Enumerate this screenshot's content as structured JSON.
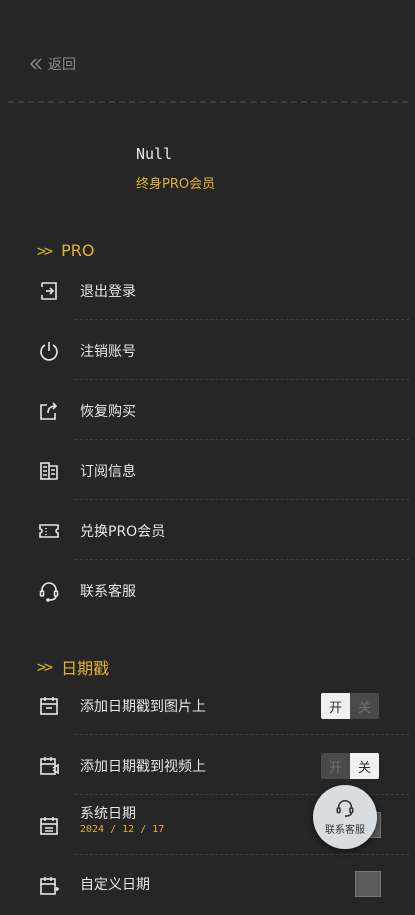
{
  "header": {
    "back_label": "返回"
  },
  "user": {
    "name": "Null",
    "status": "终身PRO会员"
  },
  "sections": {
    "pro_title": "PRO",
    "date_title": "日期戳"
  },
  "pro_items": [
    {
      "label": "退出登录",
      "icon": "logout-icon"
    },
    {
      "label": "注销账号",
      "icon": "power-icon"
    },
    {
      "label": "恢复购买",
      "icon": "restore-icon"
    },
    {
      "label": "订阅信息",
      "icon": "document-icon"
    },
    {
      "label": "兑换PRO会员",
      "icon": "ticket-icon"
    },
    {
      "label": "联系客服",
      "icon": "headset-icon"
    }
  ],
  "date_items": [
    {
      "label": "添加日期戳到图片上",
      "toggle_on": "开",
      "toggle_off": "关",
      "state": "on"
    },
    {
      "label": "添加日期戳到视频上",
      "toggle_on": "开",
      "toggle_off": "关",
      "state": "off"
    },
    {
      "label": "系统日期",
      "sub": "2024 / 12 / 17"
    },
    {
      "label": "自定义日期"
    }
  ],
  "float_button": {
    "label": "联系客服"
  },
  "colors": {
    "accent": "#e3b231",
    "background": "#262626"
  }
}
